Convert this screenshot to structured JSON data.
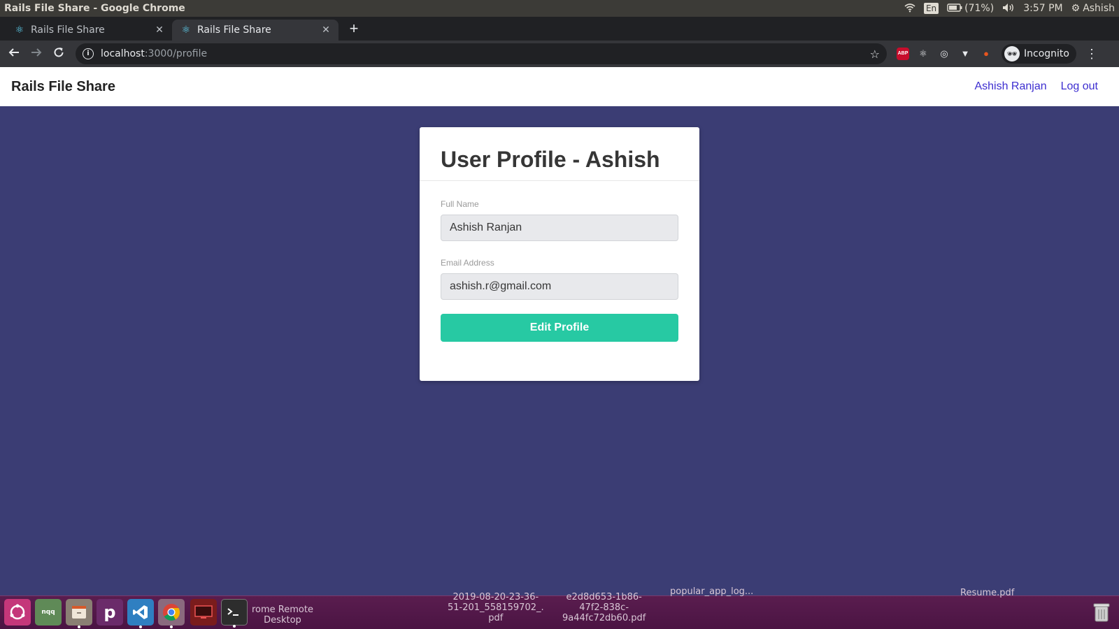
{
  "os_bar": {
    "window_title": "Rails File Share - Google Chrome",
    "lang": "En",
    "battery": "(71%)",
    "time": "3:57 PM",
    "user": "Ashish",
    "icons": [
      "wifi-icon",
      "battery-icon",
      "volume-icon",
      "gear-icon"
    ]
  },
  "browser": {
    "tabs": [
      {
        "title": "Rails File Share",
        "active": false
      },
      {
        "title": "Rails File Share",
        "active": true
      }
    ],
    "url_host": "localhost",
    "url_path": ":3000/profile",
    "incognito_label": "Incognito",
    "extensions": [
      "adblock-plus-icon",
      "react-devtools-icon",
      "target-icon",
      "vue-devtools-icon",
      "tampermonkey-icon"
    ],
    "extension_abp_text": "ABP"
  },
  "app": {
    "brand": "Rails File Share",
    "nav": {
      "user_link": "Ashish Ranjan",
      "logout_link": "Log out"
    },
    "link_color": "#3d2ed0",
    "background_color": "#3b3d74"
  },
  "profile": {
    "title": "User Profile - Ashish",
    "full_name_label": "Full Name",
    "full_name_value": "Ashish Ranjan",
    "email_label": "Email Address",
    "email_value": "ashish.r@gmail.com",
    "edit_button": "Edit Profile",
    "button_color": "#27c9a3"
  },
  "taskbar": {
    "dock_apps": [
      "ubuntu-icon",
      "nqq-icon",
      "files-icon",
      "postman-icon",
      "vscode-icon",
      "chrome-icon",
      "rdp-icon",
      "terminal-icon"
    ],
    "nqq_text": "nqq",
    "desktop_files": [
      {
        "label": "rome Remote\nDesktop"
      },
      {
        "label": "2019-08-20-23-36-\n51-201_558159702_.\npdf"
      },
      {
        "label": "e2d8d653-1b86-\n47f2-838c-\n9a44fc72db60.pdf"
      },
      {
        "label": "popular_app_log..."
      },
      {
        "label": "Resume.pdf"
      }
    ]
  }
}
